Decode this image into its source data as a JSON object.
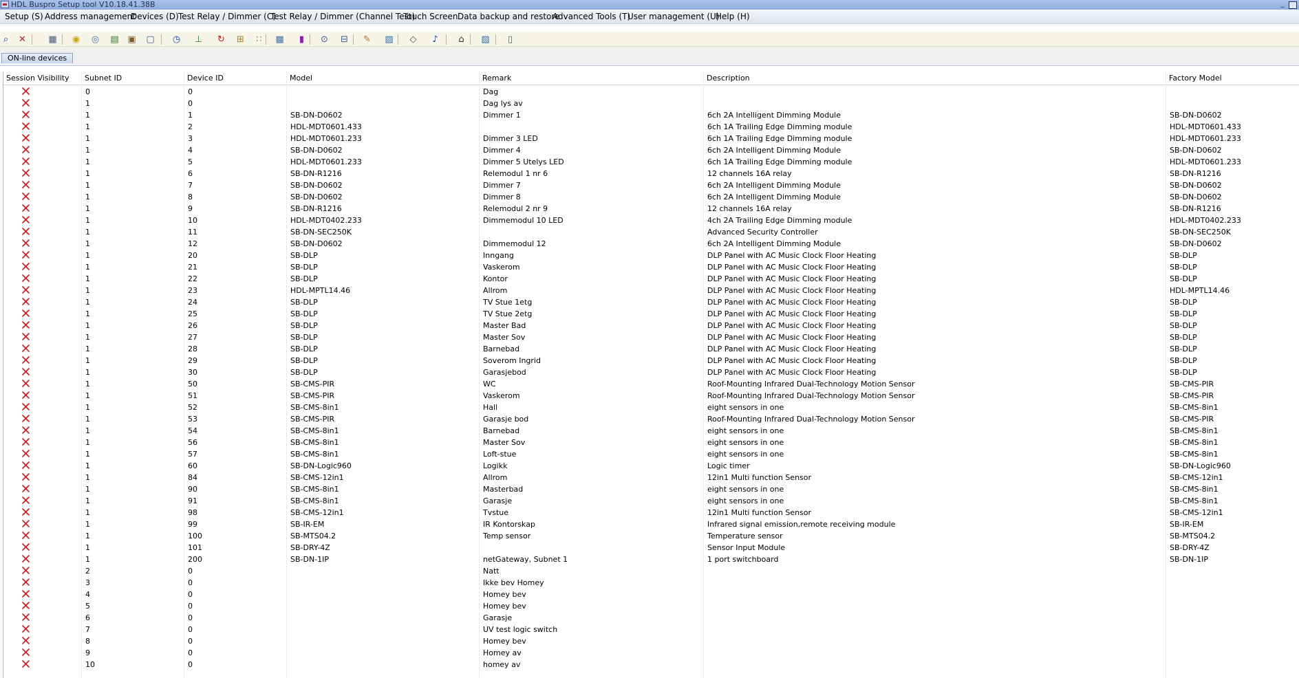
{
  "window": {
    "title": "HDL Buspro Setup tool V10.18.41.38B"
  },
  "menu": [
    "Setup (S)",
    "Address management",
    "Devices (D)",
    "Test Relay / Dimmer (C)",
    "Test Relay / Dimmer (Channel Test)",
    "Touch Screen",
    "Data backup and restore",
    "Advanced Tools (T)",
    "User management (U)",
    "Help (H)"
  ],
  "toolbar_icons": [
    "binoculars-icon",
    "delete-icon",
    "table-icon",
    "bulb-icon",
    "sensor-icon",
    "graph-icon",
    "picture-icon",
    "panel-icon",
    "clock-icon",
    "network-icon",
    "refresh-icon",
    "tree-icon",
    "grid-dots-icon",
    "keypad-icon",
    "logic-icon",
    "zoom-icon",
    "config-icon",
    "note-icon",
    "image-icon",
    "tag-icon",
    "music-icon",
    "home-icon",
    "screen-icon",
    "window-icon"
  ],
  "tab": {
    "label": "ON-line devices"
  },
  "table": {
    "columns": [
      "Session Visibility",
      "Subnet ID",
      "Device ID",
      "Model",
      "Remark",
      "Description",
      "Factory Model"
    ],
    "rows": [
      {
        "subnet": "0",
        "device": "0",
        "model": "",
        "remark": "Dag",
        "description": "",
        "factory": ""
      },
      {
        "subnet": "1",
        "device": "0",
        "model": "",
        "remark": "Dag lys av",
        "description": "",
        "factory": ""
      },
      {
        "subnet": "1",
        "device": "1",
        "model": "SB-DN-D0602",
        "remark": "Dimmer 1",
        "description": "6ch 2A Intelligent Dimming Module",
        "factory": "SB-DN-D0602"
      },
      {
        "subnet": "1",
        "device": "2",
        "model": "HDL-MDT0601.433",
        "remark": "",
        "description": "6ch 1A Trailing Edge Dimming module",
        "factory": "HDL-MDT0601.433"
      },
      {
        "subnet": "1",
        "device": "3",
        "model": "HDL-MDT0601.233",
        "remark": "Dimmer 3 LED",
        "description": "6ch 1A Trailing Edge Dimming module",
        "factory": "HDL-MDT0601.233"
      },
      {
        "subnet": "1",
        "device": "4",
        "model": "SB-DN-D0602",
        "remark": "Dimmer 4",
        "description": "6ch 2A Intelligent Dimming Module",
        "factory": "SB-DN-D0602"
      },
      {
        "subnet": "1",
        "device": "5",
        "model": "HDL-MDT0601.233",
        "remark": "Dimmer 5 Utelys LED",
        "description": "6ch 1A Trailing Edge Dimming module",
        "factory": "HDL-MDT0601.233"
      },
      {
        "subnet": "1",
        "device": "6",
        "model": "SB-DN-R1216",
        "remark": "Relemodul 1 nr 6",
        "description": "12 channels 16A relay",
        "factory": "SB-DN-R1216"
      },
      {
        "subnet": "1",
        "device": "7",
        "model": "SB-DN-D0602",
        "remark": "Dimmer 7",
        "description": "6ch 2A Intelligent Dimming Module",
        "factory": "SB-DN-D0602"
      },
      {
        "subnet": "1",
        "device": "8",
        "model": "SB-DN-D0602",
        "remark": "Dimmer 8",
        "description": "6ch 2A Intelligent Dimming Module",
        "factory": "SB-DN-D0602"
      },
      {
        "subnet": "1",
        "device": "9",
        "model": "SB-DN-R1216",
        "remark": "Relemodul 2 nr 9",
        "description": "12 channels 16A relay",
        "factory": "SB-DN-R1216"
      },
      {
        "subnet": "1",
        "device": "10",
        "model": "HDL-MDT0402.233",
        "remark": "Dimmemodul 10 LED",
        "description": "4ch 2A Trailing Edge Dimming module",
        "factory": "HDL-MDT0402.233"
      },
      {
        "subnet": "1",
        "device": "11",
        "model": "SB-DN-SEC250K",
        "remark": "",
        "description": "Advanced Security Controller",
        "factory": "SB-DN-SEC250K"
      },
      {
        "subnet": "1",
        "device": "12",
        "model": "SB-DN-D0602",
        "remark": "Dimmemodul 12",
        "description": "6ch 2A Intelligent Dimming Module",
        "factory": "SB-DN-D0602"
      },
      {
        "subnet": "1",
        "device": "20",
        "model": "SB-DLP",
        "remark": "Inngang",
        "description": "DLP Panel with AC Music Clock Floor Heating",
        "factory": "SB-DLP"
      },
      {
        "subnet": "1",
        "device": "21",
        "model": "SB-DLP",
        "remark": "Vaskerom",
        "description": "DLP Panel with AC Music Clock Floor Heating",
        "factory": "SB-DLP"
      },
      {
        "subnet": "1",
        "device": "22",
        "model": "SB-DLP",
        "remark": "Kontor",
        "description": "DLP Panel with AC Music Clock Floor Heating",
        "factory": "SB-DLP"
      },
      {
        "subnet": "1",
        "device": "23",
        "model": "HDL-MPTL14.46",
        "remark": "Allrom",
        "description": "DLP Panel with AC Music Clock Floor Heating",
        "factory": "HDL-MPTL14.46"
      },
      {
        "subnet": "1",
        "device": "24",
        "model": "SB-DLP",
        "remark": "TV Stue 1etg",
        "description": "DLP Panel with AC Music Clock Floor Heating",
        "factory": "SB-DLP"
      },
      {
        "subnet": "1",
        "device": "25",
        "model": "SB-DLP",
        "remark": "TV Stue 2etg",
        "description": "DLP Panel with AC Music Clock Floor Heating",
        "factory": "SB-DLP"
      },
      {
        "subnet": "1",
        "device": "26",
        "model": "SB-DLP",
        "remark": "Master Bad",
        "description": "DLP Panel with AC Music Clock Floor Heating",
        "factory": "SB-DLP"
      },
      {
        "subnet": "1",
        "device": "27",
        "model": "SB-DLP",
        "remark": "Master Sov",
        "description": "DLP Panel with AC Music Clock Floor Heating",
        "factory": "SB-DLP"
      },
      {
        "subnet": "1",
        "device": "28",
        "model": "SB-DLP",
        "remark": "Barnebad",
        "description": "DLP Panel with AC Music Clock Floor Heating",
        "factory": "SB-DLP"
      },
      {
        "subnet": "1",
        "device": "29",
        "model": "SB-DLP",
        "remark": "Soverom Ingrid",
        "description": "DLP Panel with AC Music Clock Floor Heating",
        "factory": "SB-DLP"
      },
      {
        "subnet": "1",
        "device": "30",
        "model": "SB-DLP",
        "remark": "Garasjebod",
        "description": "DLP Panel with AC Music Clock Floor Heating",
        "factory": "SB-DLP"
      },
      {
        "subnet": "1",
        "device": "50",
        "model": "SB-CMS-PIR",
        "remark": "WC",
        "description": "Roof-Mounting Infrared Dual-Technology Motion Sensor",
        "factory": "SB-CMS-PIR"
      },
      {
        "subnet": "1",
        "device": "51",
        "model": "SB-CMS-PIR",
        "remark": "Vaskerom",
        "description": "Roof-Mounting Infrared Dual-Technology Motion Sensor",
        "factory": "SB-CMS-PIR"
      },
      {
        "subnet": "1",
        "device": "52",
        "model": "SB-CMS-8in1",
        "remark": "Hall",
        "description": "eight sensors in one",
        "factory": "SB-CMS-8in1"
      },
      {
        "subnet": "1",
        "device": "53",
        "model": "SB-CMS-PIR",
        "remark": "Garasje bod",
        "description": "Roof-Mounting Infrared Dual-Technology Motion Sensor",
        "factory": "SB-CMS-PIR"
      },
      {
        "subnet": "1",
        "device": "54",
        "model": "SB-CMS-8in1",
        "remark": "Barnebad",
        "description": "eight sensors in one",
        "factory": "SB-CMS-8in1"
      },
      {
        "subnet": "1",
        "device": "56",
        "model": "SB-CMS-8in1",
        "remark": "Master Sov",
        "description": "eight sensors in one",
        "factory": "SB-CMS-8in1"
      },
      {
        "subnet": "1",
        "device": "57",
        "model": "SB-CMS-8in1",
        "remark": "Loft-stue",
        "description": "eight sensors in one",
        "factory": "SB-CMS-8in1"
      },
      {
        "subnet": "1",
        "device": "60",
        "model": "SB-DN-Logic960",
        "remark": "Logikk",
        "description": "Logic timer",
        "factory": "SB-DN-Logic960"
      },
      {
        "subnet": "1",
        "device": "84",
        "model": "SB-CMS-12in1",
        "remark": "Allrom",
        "description": "12in1 Multi function Sensor",
        "factory": "SB-CMS-12in1"
      },
      {
        "subnet": "1",
        "device": "90",
        "model": "SB-CMS-8in1",
        "remark": "Masterbad",
        "description": "eight sensors in one",
        "factory": "SB-CMS-8in1"
      },
      {
        "subnet": "1",
        "device": "91",
        "model": "SB-CMS-8in1",
        "remark": "Garasje",
        "description": "eight sensors in one",
        "factory": "SB-CMS-8in1"
      },
      {
        "subnet": "1",
        "device": "98",
        "model": "SB-CMS-12in1",
        "remark": "Tvstue",
        "description": "12in1 Multi function Sensor",
        "factory": "SB-CMS-12in1"
      },
      {
        "subnet": "1",
        "device": "99",
        "model": "SB-IR-EM",
        "remark": "IR Kontorskap",
        "description": "Infrared signal emission,remote receiving module",
        "factory": "SB-IR-EM"
      },
      {
        "subnet": "1",
        "device": "100",
        "model": "SB-MTS04.2",
        "remark": "Temp sensor",
        "description": "Temperature sensor",
        "factory": "SB-MTS04.2"
      },
      {
        "subnet": "1",
        "device": "101",
        "model": "SB-DRY-4Z",
        "remark": "",
        "description": "Sensor Input Module",
        "factory": "SB-DRY-4Z"
      },
      {
        "subnet": "1",
        "device": "200",
        "model": "SB-DN-1IP",
        "remark": "netGateway, Subnet 1",
        "description": "1 port switchboard",
        "factory": "SB-DN-1IP"
      },
      {
        "subnet": "2",
        "device": "0",
        "model": "",
        "remark": "Natt",
        "description": "",
        "factory": ""
      },
      {
        "subnet": "3",
        "device": "0",
        "model": "",
        "remark": "Ikke bev Homey",
        "description": "",
        "factory": ""
      },
      {
        "subnet": "4",
        "device": "0",
        "model": "",
        "remark": "Homey bev",
        "description": "",
        "factory": ""
      },
      {
        "subnet": "5",
        "device": "0",
        "model": "",
        "remark": "Homey bev",
        "description": "",
        "factory": ""
      },
      {
        "subnet": "6",
        "device": "0",
        "model": "",
        "remark": "Garasje",
        "description": "",
        "factory": ""
      },
      {
        "subnet": "7",
        "device": "0",
        "model": "",
        "remark": "UV test logic switch",
        "description": "",
        "factory": ""
      },
      {
        "subnet": "8",
        "device": "0",
        "model": "",
        "remark": "Homey bev",
        "description": "",
        "factory": ""
      },
      {
        "subnet": "9",
        "device": "0",
        "model": "",
        "remark": "Homey av",
        "description": "",
        "factory": ""
      },
      {
        "subnet": "10",
        "device": "0",
        "model": "",
        "remark": "homey av",
        "description": "",
        "factory": ""
      }
    ]
  },
  "colors": {
    "visibility_x": "#c21b1b",
    "titlebar": "#a9c1ea",
    "menubar": "#e6ebf3",
    "toolbar": "#f7f4e8"
  }
}
